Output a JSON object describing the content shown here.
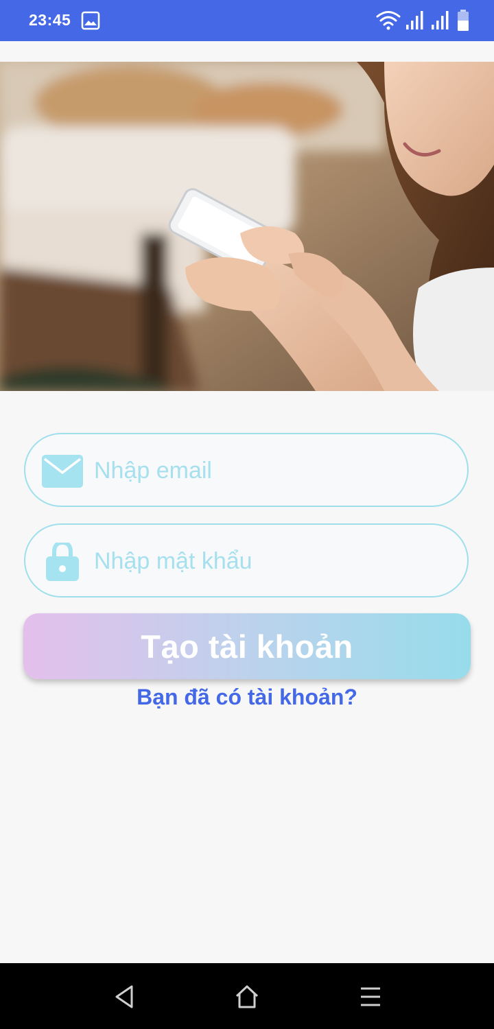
{
  "status_bar": {
    "time": "23:45",
    "icons": [
      "image-icon",
      "wifi-icon",
      "signal-icon",
      "signal-icon",
      "battery-icon"
    ]
  },
  "hero": {
    "description_icon": "hero-photo"
  },
  "form": {
    "email": {
      "placeholder": "Nhập email",
      "value": "",
      "icon": "mail-icon"
    },
    "password": {
      "placeholder": "Nhập mật khẩu",
      "value": "",
      "icon": "lock-icon"
    },
    "create_button_label": "Tạo tài khoản",
    "login_link_label": "Bạn đã có tài khoản?"
  },
  "nav_bar": {
    "icons": [
      "back-icon",
      "home-icon",
      "menu-icon"
    ]
  },
  "colors": {
    "primary": "#4568e6",
    "input_border": "#9fdfec",
    "placeholder": "#a6dfee",
    "button_gradient_start": "#e4bfec",
    "button_gradient_end": "#97dceb"
  }
}
